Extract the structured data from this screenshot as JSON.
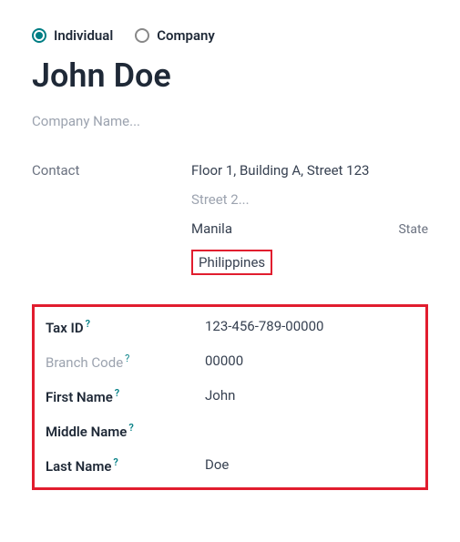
{
  "contactType": {
    "individual": "Individual",
    "company": "Company"
  },
  "name": "John Doe",
  "companyPlaceholder": "Company Name...",
  "labels": {
    "contact": "Contact",
    "taxId": "Tax ID",
    "branchCode": "Branch Code",
    "firstName": "First Name",
    "middleName": "Middle Name",
    "lastName": "Last Name"
  },
  "address": {
    "street1": "Floor 1, Building A, Street 123",
    "street2Placeholder": "Street 2...",
    "city": "Manila",
    "stateLabel": "State",
    "country": "Philippines"
  },
  "tax": {
    "taxId": "123-456-789-00000",
    "branchCode": "00000",
    "firstName": "John",
    "middleName": "",
    "lastName": "Doe"
  },
  "helpGlyph": "?"
}
